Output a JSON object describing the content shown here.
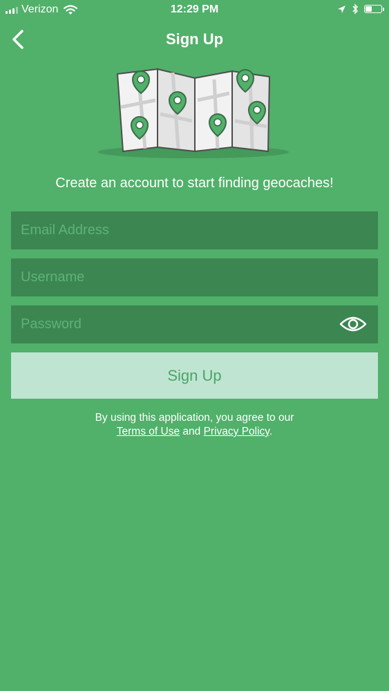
{
  "status_bar": {
    "carrier": "Verizon",
    "time": "12:29 PM",
    "battery_level": 0.45,
    "icons": [
      "signal-icon",
      "wifi-icon",
      "location-icon",
      "bluetooth-icon",
      "battery-icon"
    ]
  },
  "nav": {
    "title": "Sign Up",
    "back_icon": "chevron-left-icon"
  },
  "illustration": {
    "icon": "folded-map-with-pins"
  },
  "subtitle": "Create an account to start finding geocaches!",
  "form": {
    "email_placeholder": "Email Address",
    "username_placeholder": "Username",
    "password_placeholder": "Password",
    "password_toggle_icon": "eye-icon",
    "submit_label": "Sign Up"
  },
  "legal": {
    "line1": "By using this application, you agree to our",
    "terms_label": "Terms of Use",
    "and": "and",
    "privacy_label": "Privacy Policy",
    "period": "."
  },
  "colors": {
    "background": "#51b06a",
    "field_background": "#3c8651",
    "button_background": "#bfe5d2",
    "button_text": "#4aa565"
  }
}
